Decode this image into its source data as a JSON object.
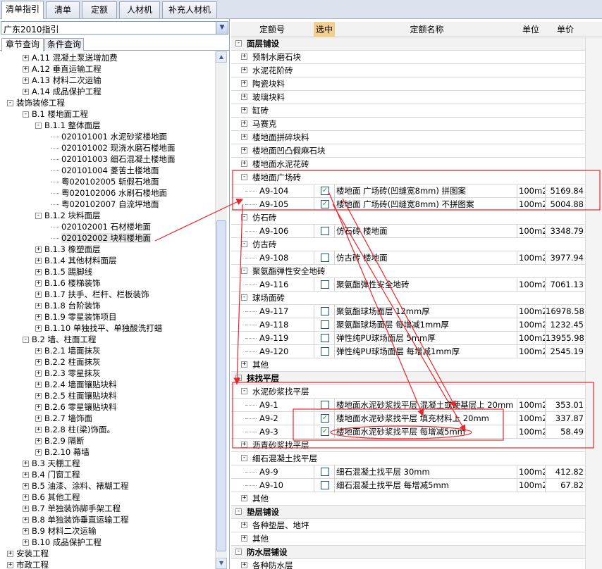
{
  "tabs": [
    "清单指引",
    "清单",
    "定额",
    "人材机",
    "补充人材机"
  ],
  "left": {
    "combo_value": "广东2010指引",
    "subtabs": [
      "章节查询",
      "条件查询"
    ],
    "tree": [
      {
        "d": 2,
        "e": "+",
        "t": "A.11 混凝土泵送增加费"
      },
      {
        "d": 2,
        "e": "+",
        "t": "A.12 垂直运输工程"
      },
      {
        "d": 2,
        "e": "+",
        "t": "A.13 材料二次运输"
      },
      {
        "d": 2,
        "e": "+",
        "t": "A.14 成品保护工程"
      },
      {
        "d": 1,
        "e": "-",
        "t": "装饰装修工程"
      },
      {
        "d": 2,
        "e": "-",
        "t": "B.1 楼地面工程"
      },
      {
        "d": 3,
        "e": "-",
        "t": "B.1.1 整体面层"
      },
      {
        "d": 4,
        "e": "",
        "t": "020101001  水泥砂浆楼地面"
      },
      {
        "d": 4,
        "e": "",
        "t": "020101002  现浇水磨石楼地面"
      },
      {
        "d": 4,
        "e": "",
        "t": "020101003  细石混凝土楼地面"
      },
      {
        "d": 4,
        "e": "",
        "t": "020101004  菱苦土楼地面"
      },
      {
        "d": 4,
        "e": "",
        "t": "粤020102005  斩假石地面"
      },
      {
        "d": 4,
        "e": "",
        "t": "粤020102006  水刷石楼地面"
      },
      {
        "d": 4,
        "e": "",
        "t": "粤020102007  自流坪地面"
      },
      {
        "d": 3,
        "e": "-",
        "t": "B.1.2 块料面层"
      },
      {
        "d": 4,
        "e": "",
        "t": "020102001  石材楼地面"
      },
      {
        "d": 4,
        "e": "",
        "t": "020102002  块料楼地面",
        "sel": true
      },
      {
        "d": 3,
        "e": "+",
        "t": "B.1.3 橡塑面层"
      },
      {
        "d": 3,
        "e": "+",
        "t": "B.1.4 其他材料面层"
      },
      {
        "d": 3,
        "e": "+",
        "t": "B.1.5 踢脚线"
      },
      {
        "d": 3,
        "e": "+",
        "t": "B.1.6 楼梯装饰"
      },
      {
        "d": 3,
        "e": "+",
        "t": "B.1.7 扶手、栏杆、栏板装饰"
      },
      {
        "d": 3,
        "e": "+",
        "t": "B.1.8 台阶装饰"
      },
      {
        "d": 3,
        "e": "+",
        "t": "B.1.9 零星装饰项目"
      },
      {
        "d": 3,
        "e": "+",
        "t": "B.1.10 单独找平、单独酸洗打蜡"
      },
      {
        "d": 2,
        "e": "-",
        "t": "B.2 墙、柱面工程"
      },
      {
        "d": 3,
        "e": "+",
        "t": "B.2.1 墙面抹灰"
      },
      {
        "d": 3,
        "e": "+",
        "t": "B.2.2 柱面抹灰"
      },
      {
        "d": 3,
        "e": "+",
        "t": "B.2.3 零星抹灰"
      },
      {
        "d": 3,
        "e": "+",
        "t": "B.2.4 墙面镶贴块料"
      },
      {
        "d": 3,
        "e": "+",
        "t": "B.2.5 柱面镶贴块料"
      },
      {
        "d": 3,
        "e": "+",
        "t": "B.2.6 零星镶贴块料"
      },
      {
        "d": 3,
        "e": "+",
        "t": "B.2.7 墙饰面"
      },
      {
        "d": 3,
        "e": "+",
        "t": "B.2.8 柱(梁)饰面。"
      },
      {
        "d": 3,
        "e": "+",
        "t": "B.2.9 隔断"
      },
      {
        "d": 3,
        "e": "+",
        "t": "B.2.10 幕墙"
      },
      {
        "d": 2,
        "e": "+",
        "t": "B.3 天棚工程"
      },
      {
        "d": 2,
        "e": "+",
        "t": "B.4 门窗工程"
      },
      {
        "d": 2,
        "e": "+",
        "t": "B.5 油漆、涂料、裱糊工程"
      },
      {
        "d": 2,
        "e": "+",
        "t": "B.6 其他工程"
      },
      {
        "d": 2,
        "e": "+",
        "t": "B.7 单独装饰脚手架工程"
      },
      {
        "d": 2,
        "e": "+",
        "t": "B.8 单独装饰垂直运输工程"
      },
      {
        "d": 2,
        "e": "+",
        "t": "B.9 材料二次运输"
      },
      {
        "d": 2,
        "e": "+",
        "t": "B.10 成品保护工程"
      },
      {
        "d": 1,
        "e": "+",
        "t": "安装工程"
      },
      {
        "d": 1,
        "e": "+",
        "t": "市政工程"
      }
    ]
  },
  "right": {
    "headers": {
      "code": "定额号",
      "select": "选中",
      "name": "定额名称",
      "unit": "单位",
      "price": "单价"
    },
    "rows": [
      {
        "k": "g",
        "e": "-",
        "t": "面层铺设"
      },
      {
        "k": "c",
        "e": "+",
        "t": "预制水磨石块"
      },
      {
        "k": "c",
        "e": "+",
        "t": "水泥花阶砖"
      },
      {
        "k": "c",
        "e": "+",
        "t": "陶瓷块料"
      },
      {
        "k": "c",
        "e": "+",
        "t": "玻璃块料"
      },
      {
        "k": "c",
        "e": "+",
        "t": "缸砖"
      },
      {
        "k": "c",
        "e": "+",
        "t": "马赛克"
      },
      {
        "k": "c",
        "e": "+",
        "t": "楼地面拼碎块料"
      },
      {
        "k": "c",
        "e": "+",
        "t": "楼地面凹凸假麻石块"
      },
      {
        "k": "c",
        "e": "+",
        "t": "楼地面水泥花砖"
      },
      {
        "k": "c",
        "e": "-",
        "t": "楼地面广场砖"
      },
      {
        "k": "i",
        "code": "A9-104",
        "chk": true,
        "name": "楼地面 广场砖(凹缝宽8mm) 拼图案",
        "unit": "100m2",
        "price": "5169.84"
      },
      {
        "k": "i",
        "code": "A9-105",
        "chk": true,
        "name": "楼地面 广场砖(凹缝宽8mm) 不拼图案",
        "unit": "100m2",
        "price": "5004.88"
      },
      {
        "k": "c",
        "e": "-",
        "t": "仿石砖"
      },
      {
        "k": "i",
        "code": "A9-106",
        "chk": false,
        "name": "仿石砖 楼地面",
        "unit": "100m2",
        "price": "3348.79"
      },
      {
        "k": "c",
        "e": "-",
        "t": "仿古砖"
      },
      {
        "k": "i",
        "code": "A9-108",
        "chk": false,
        "name": "仿古砖 楼地面",
        "unit": "100m2",
        "price": "3977.94"
      },
      {
        "k": "c",
        "e": "-",
        "t": "聚氨酯弹性安全地砖"
      },
      {
        "k": "i",
        "code": "A9-116",
        "chk": false,
        "name": "聚氨酯弹性安全地砖",
        "unit": "100m2",
        "price": "7061.13"
      },
      {
        "k": "c",
        "e": "-",
        "t": "球场面砖"
      },
      {
        "k": "i",
        "code": "A9-117",
        "chk": false,
        "name": "聚氨酯球场面层 12mm厚",
        "unit": "100m2",
        "price": "16978.58"
      },
      {
        "k": "i",
        "code": "A9-118",
        "chk": false,
        "name": "聚氨酯球场面层 每增减1mm厚",
        "unit": "100m2",
        "price": "1232.45"
      },
      {
        "k": "i",
        "code": "A9-119",
        "chk": false,
        "name": "弹性纯PU球场面层 5mm厚",
        "unit": "100m2",
        "price": "13955.98"
      },
      {
        "k": "i",
        "code": "A9-120",
        "chk": false,
        "name": "弹性纯PU球场面层 每增减1mm厚",
        "unit": "100m2",
        "price": "2545.19"
      },
      {
        "k": "c",
        "e": "+",
        "t": "其他"
      },
      {
        "k": "g",
        "e": "-",
        "t": "抹找平层"
      },
      {
        "k": "c",
        "e": "-",
        "t": "水泥砂浆找平层"
      },
      {
        "k": "i",
        "code": "A9-1",
        "chk": false,
        "name": "楼地面水泥砂浆找平层 混凝土或硬基层上 20mm",
        "unit": "100m2",
        "price": "353.01"
      },
      {
        "k": "i",
        "code": "A9-2",
        "chk": true,
        "name": "楼地面水泥砂浆找平层 填充材料上 20mm",
        "unit": "100m2",
        "price": "337.87"
      },
      {
        "k": "i",
        "code": "A9-3",
        "chk": true,
        "name": "楼地面水泥砂浆找平层 每增减5mm",
        "unit": "100m2",
        "price": "58.49"
      },
      {
        "k": "c",
        "e": "+",
        "t": "沥青砂浆找平层"
      },
      {
        "k": "c",
        "e": "-",
        "t": "细石混凝土找平层"
      },
      {
        "k": "i",
        "code": "A9-9",
        "chk": false,
        "name": "细石混凝土找平层   30mm",
        "unit": "100m2",
        "price": "412.82"
      },
      {
        "k": "i",
        "code": "A9-10",
        "chk": false,
        "name": "细石混凝土找平层   每增减5mm",
        "unit": "100m2",
        "price": "67.82"
      },
      {
        "k": "c",
        "e": "+",
        "t": "其他"
      },
      {
        "k": "g",
        "e": "-",
        "t": "垫层铺设"
      },
      {
        "k": "c",
        "e": "+",
        "t": "各种垫层、地坪"
      },
      {
        "k": "c",
        "e": "+",
        "t": "其他"
      },
      {
        "k": "g",
        "e": "-",
        "t": "防水层铺设"
      },
      {
        "k": "c",
        "e": "+",
        "t": "各种防水层"
      }
    ]
  },
  "colors": {
    "annotation": "#e8262b",
    "select_header": "#f5cf8e",
    "check": "#21a121"
  }
}
